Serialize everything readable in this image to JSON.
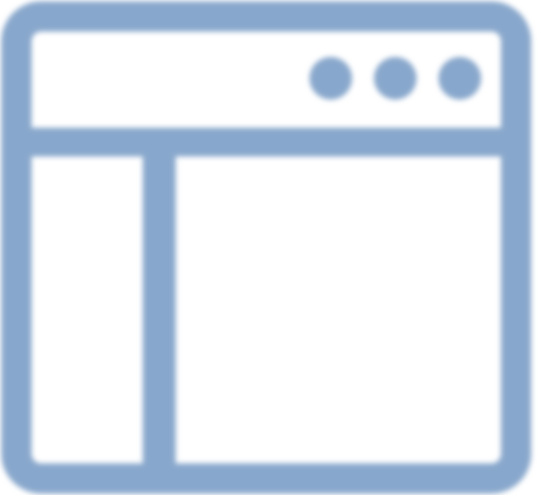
{
  "icon": {
    "name": "browser-window-sidebar-icon",
    "color": "#88a7cc",
    "background": "#ffffff"
  }
}
